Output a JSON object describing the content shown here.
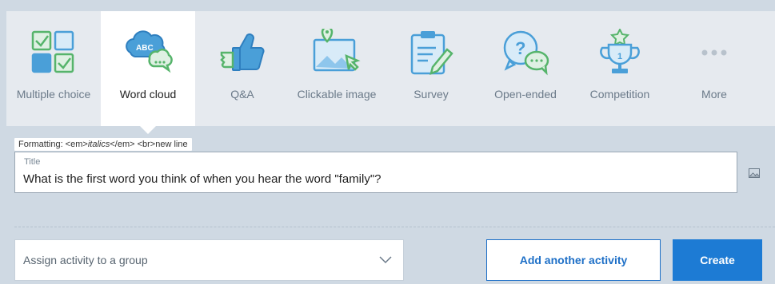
{
  "tabs": [
    {
      "label": "Multiple choice",
      "icon": "multiple-choice-icon",
      "active": false
    },
    {
      "label": "Word cloud",
      "icon": "word-cloud-icon",
      "active": true,
      "icon_text": "ABC"
    },
    {
      "label": "Q&A",
      "icon": "thumbs-up-icon",
      "active": false
    },
    {
      "label": "Clickable image",
      "icon": "clickable-image-icon",
      "active": false
    },
    {
      "label": "Survey",
      "icon": "survey-clipboard-icon",
      "active": false
    },
    {
      "label": "Open-ended",
      "icon": "open-ended-question-icon",
      "active": false
    },
    {
      "label": "Competition",
      "icon": "trophy-icon",
      "active": false,
      "icon_text": "1"
    },
    {
      "label": "More",
      "icon": "more-dots-icon",
      "active": false
    }
  ],
  "formatting_hint": {
    "prefix": "Formatting: <em>",
    "italic": "italics",
    "suffix": "</em> <br>new line"
  },
  "title_field": {
    "label": "Title",
    "value": "What is the first word you think of when you hear the word \"family\"?"
  },
  "group_select": {
    "placeholder": "Assign activity to a group"
  },
  "buttons": {
    "add_another": "Add another activity",
    "create": "Create"
  },
  "colors": {
    "icon_blue": "#4a9fd8",
    "icon_green": "#56b46b",
    "accent": "#1d7bd4",
    "background": "#cfd9e3",
    "tab_strip": "#e6eaef"
  }
}
